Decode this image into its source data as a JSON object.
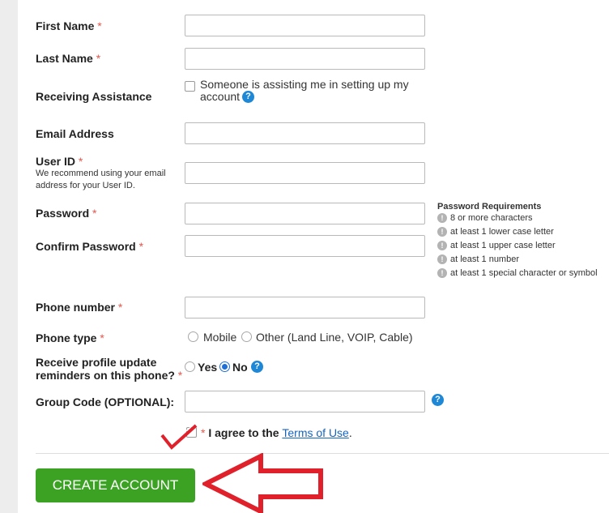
{
  "form": {
    "first_name_label": "First Name",
    "last_name_label": "Last Name",
    "receiving_assistance_label": "Receiving Assistance",
    "assistance_checkbox_line1": "Someone is assisting me in setting up my",
    "assistance_checkbox_line2": "account",
    "email_label": "Email Address",
    "user_id_label": "User ID",
    "user_id_hint_line1": "We recommend using your email",
    "user_id_hint_line2": "address for your User ID.",
    "password_label": "Password",
    "confirm_password_label": "Confirm Password",
    "phone_number_label": "Phone number",
    "phone_type_label": "Phone type",
    "phone_type_options": [
      "Mobile",
      "Other (Land Line, VOIP, Cable)"
    ],
    "reminders_label_line1": "Receive profile update",
    "reminders_label_line2": "reminders on this phone?",
    "reminders_yes": "Yes",
    "reminders_no": "No",
    "reminders_selected": "No",
    "group_code_label": "Group Code (OPTIONAL):",
    "required_marker": "*",
    "help_glyph": "?",
    "agree_text": "I agree to the",
    "terms_link": "Terms of Use",
    "agree_period": ".",
    "create_button": "CREATE ACCOUNT"
  },
  "password_requirements": {
    "title": "Password Requirements",
    "items": [
      "8 or more characters",
      "at least 1 lower case letter",
      "at least 1 upper case letter",
      "at least 1 number",
      "at least 1 special character or symbol"
    ]
  },
  "colors": {
    "accent_green": "#3ca224",
    "required_red": "#e8564b",
    "help_blue": "#1e88d6",
    "annotation_red": "#e0202a"
  }
}
